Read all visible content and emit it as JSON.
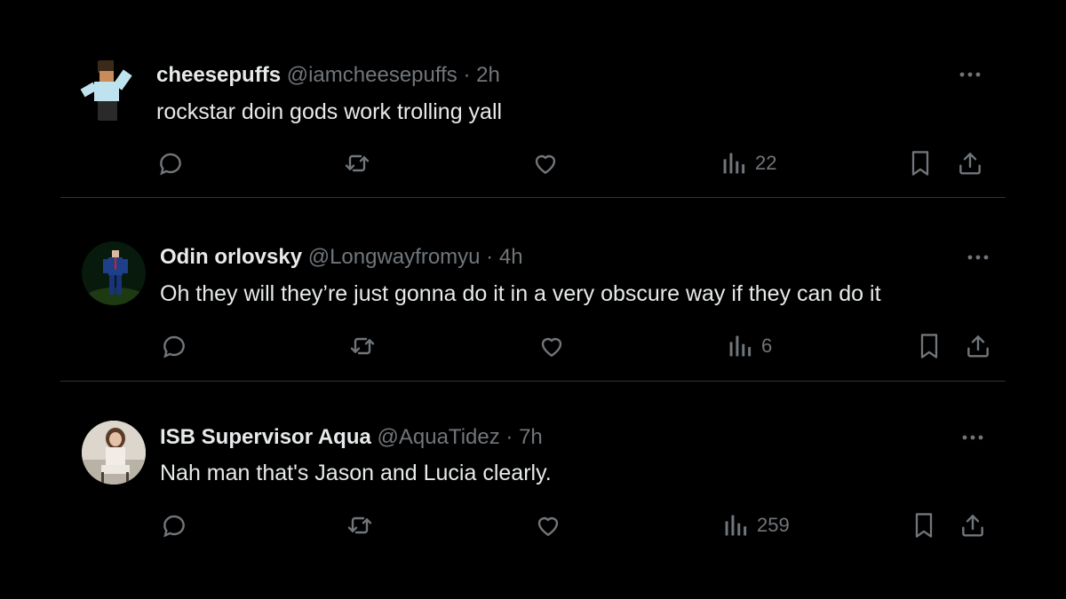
{
  "posts": [
    {
      "display_name": "cheesepuffs",
      "handle": "@iamcheesepuffs",
      "separator": "·",
      "time": "2h",
      "text": "rockstar doin gods work trolling yall",
      "views": "22",
      "avatar": "pixel-character-avatar"
    },
    {
      "display_name": "Odin orlovsky",
      "handle": "@Longwayfromyu",
      "separator": "·",
      "time": "4h",
      "text": "Oh they will they’re just gonna do it in a very obscure way if they can do it",
      "views": "6",
      "avatar": "person-in-suit-avatar"
    },
    {
      "display_name": "ISB Supervisor Aqua",
      "handle": "@AquaTidez",
      "separator": "·",
      "time": "7h",
      "text": "Nah man that's Jason and Lucia clearly.",
      "views": "259",
      "avatar": "seated-woman-avatar"
    }
  ],
  "icons": [
    "more-icon",
    "reply-icon",
    "repost-icon",
    "like-icon",
    "views-icon",
    "bookmark-icon",
    "share-icon"
  ],
  "colors": {
    "background": "#000000",
    "text": "#e7e9ea",
    "muted": "#71767b",
    "divider": "#2f3336"
  }
}
